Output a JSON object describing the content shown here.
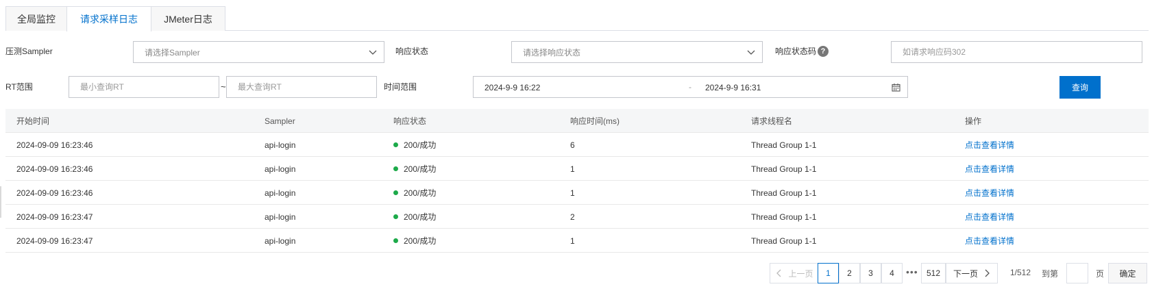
{
  "tabs": [
    {
      "label": "全局监控",
      "active": false
    },
    {
      "label": "请求采样日志",
      "active": true
    },
    {
      "label": "JMeter日志",
      "active": false
    }
  ],
  "filters": {
    "sampler_label": "压测Sampler",
    "sampler_placeholder": "请选择Sampler",
    "status_label": "响应状态",
    "status_placeholder": "请选择响应状态",
    "code_label": "响应状态码",
    "code_help": "?",
    "code_placeholder": "如请求响应码302",
    "rt_label": "RT范围",
    "rt_min_placeholder": "最小查询RT",
    "rt_sep": "~",
    "rt_max_placeholder": "最大查询RT",
    "time_label": "时间范围",
    "time_start": "2024-9-9 16:22",
    "time_sep": "-",
    "time_end": "2024-9-9 16:31",
    "query_button": "查询"
  },
  "table": {
    "columns": [
      "开始时间",
      "Sampler",
      "响应状态",
      "响应时间(ms)",
      "请求线程名",
      "操作"
    ],
    "rows": [
      {
        "start": "2024-09-09 16:23:46",
        "sampler": "api-login",
        "status": "200/成功",
        "rt": "6",
        "thread": "Thread Group 1-1",
        "action": "点击查看详情"
      },
      {
        "start": "2024-09-09 16:23:46",
        "sampler": "api-login",
        "status": "200/成功",
        "rt": "1",
        "thread": "Thread Group 1-1",
        "action": "点击查看详情"
      },
      {
        "start": "2024-09-09 16:23:46",
        "sampler": "api-login",
        "status": "200/成功",
        "rt": "1",
        "thread": "Thread Group 1-1",
        "action": "点击查看详情"
      },
      {
        "start": "2024-09-09 16:23:47",
        "sampler": "api-login",
        "status": "200/成功",
        "rt": "2",
        "thread": "Thread Group 1-1",
        "action": "点击查看详情"
      },
      {
        "start": "2024-09-09 16:23:47",
        "sampler": "api-login",
        "status": "200/成功",
        "rt": "1",
        "thread": "Thread Group 1-1",
        "action": "点击查看详情"
      }
    ],
    "status_color": "#1daa4a"
  },
  "pagination": {
    "prev": "上一页",
    "pages": [
      "1",
      "2",
      "3",
      "4"
    ],
    "ellipsis": "•••",
    "last": "512",
    "next": "下一页",
    "summary": "1/512",
    "goto_label": "到第",
    "page_unit": "页",
    "confirm": "确定"
  },
  "colors": {
    "accent": "#0070cc",
    "success": "#1daa4a"
  }
}
